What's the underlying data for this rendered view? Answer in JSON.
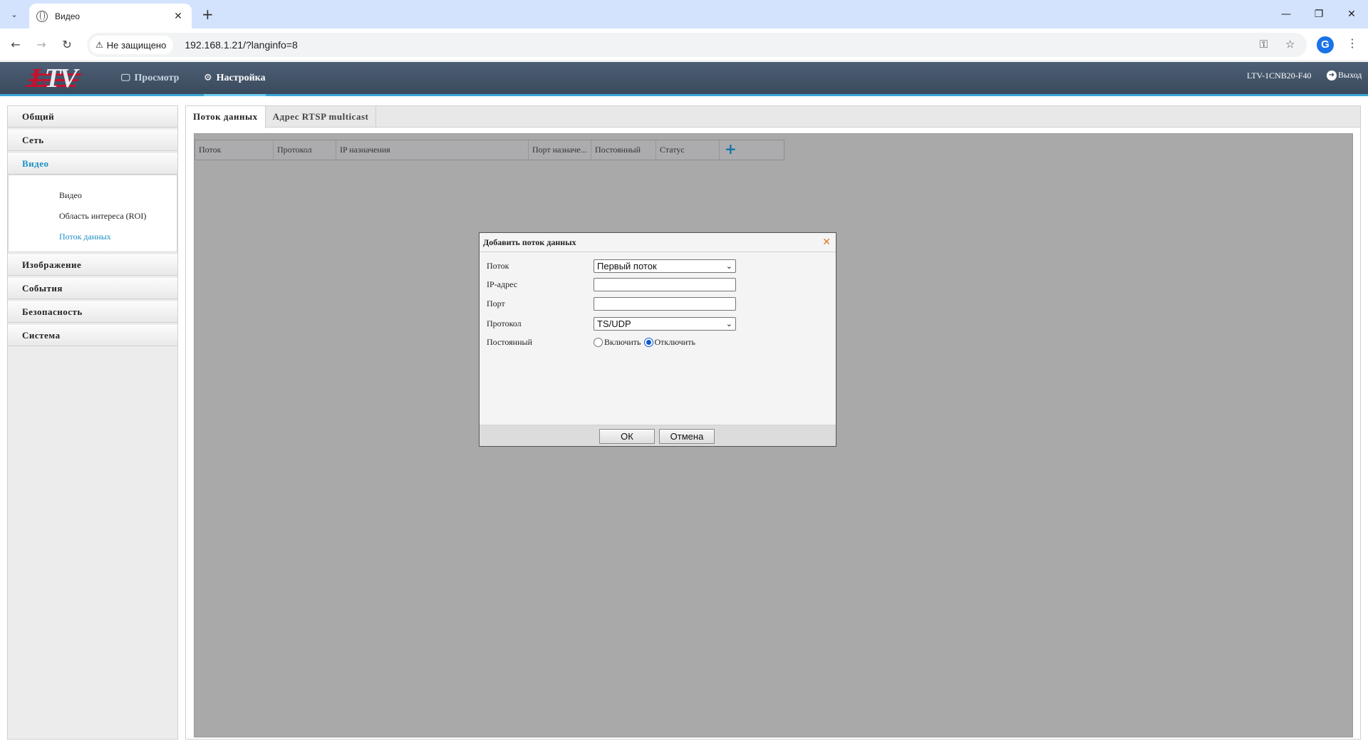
{
  "browser": {
    "tab_title": "Видео",
    "security_label": "Не защищено",
    "url": "192.168.1.21/?langinfo=8",
    "profile_initial": "G"
  },
  "header": {
    "nav_preview": "Просмотр",
    "nav_settings": "Настройка",
    "device_name": "LTV-1CNB20-F40",
    "logout": "Выход",
    "accent_color": "#3aa6d6"
  },
  "sidebar": {
    "items": [
      {
        "label": "Общий"
      },
      {
        "label": "Сеть"
      },
      {
        "label": "Видео",
        "active": true
      },
      {
        "label": "Изображение"
      },
      {
        "label": "События"
      },
      {
        "label": "Безопасность"
      },
      {
        "label": "Система"
      }
    ],
    "video_submenu": [
      {
        "label": "Видео"
      },
      {
        "label": "Область интереса (ROI)"
      },
      {
        "label": "Поток данных",
        "active": true
      }
    ]
  },
  "content": {
    "tabs": [
      {
        "label": "Поток данных",
        "active": true
      },
      {
        "label": "Адрес RTSP multicast"
      }
    ],
    "columns": [
      "Поток",
      "Протокол",
      "IP назначения",
      "Порт назначе...",
      "Постоянный",
      "Статус"
    ],
    "add_icon": "+"
  },
  "dialog": {
    "title": "Добавить поток данных",
    "fields": {
      "stream_label": "Поток",
      "stream_value": "Первый поток",
      "ip_label": "IP-адрес",
      "ip_value": "",
      "port_label": "Порт",
      "port_value": "",
      "protocol_label": "Протокол",
      "protocol_value": "TS/UDP",
      "persistent_label": "Постоянный",
      "persistent_on": "Включить",
      "persistent_off": "Отключить",
      "persistent_selected": "off"
    },
    "ok": "ОК",
    "cancel": "Отмена"
  }
}
